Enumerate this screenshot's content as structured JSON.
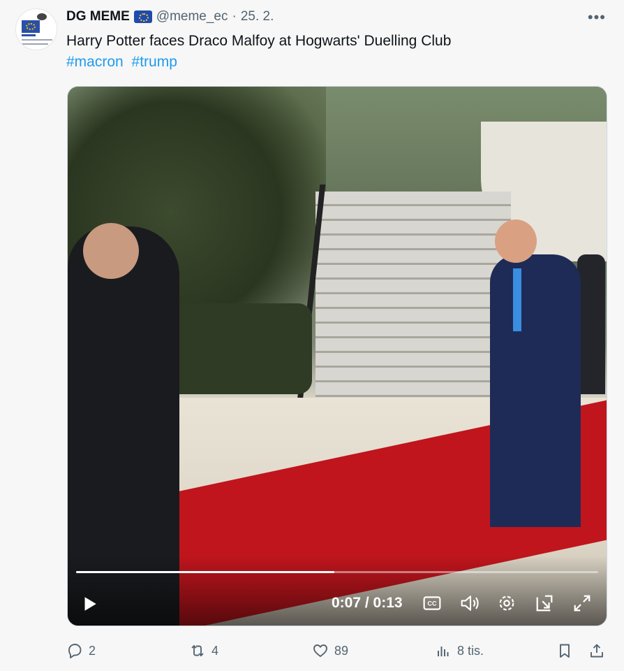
{
  "tweet": {
    "display_name": "DG MEME",
    "handle": "@meme_ec",
    "separator": "·",
    "date": "25. 2.",
    "more_label": "•••",
    "text": "Harry Potter faces Draco Malfoy at Hogwarts' Duelling Club",
    "hashtags": [
      "#macron",
      "#trump"
    ],
    "avatar_text": "DG MEME"
  },
  "video": {
    "time_label": "0:07 / 0:13",
    "progress": 0.495
  },
  "actions": {
    "replies": "2",
    "reposts": "4",
    "likes": "89",
    "views": "8 tis."
  },
  "colors": {
    "accent": "#1d9bf0",
    "muted": "#536471",
    "carpet": "#c0151d"
  }
}
